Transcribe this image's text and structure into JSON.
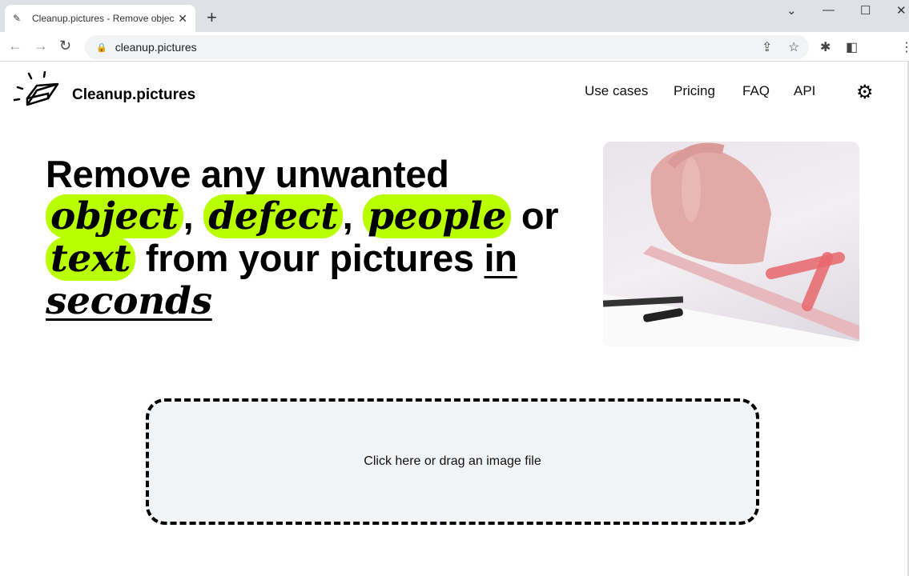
{
  "browser": {
    "tab_title": "Cleanup.pictures - Remove objec",
    "url": "cleanup.pictures"
  },
  "header": {
    "brand": "Cleanup.pictures",
    "menu": [
      "Use cases",
      "Pricing",
      "FAQ",
      "API"
    ]
  },
  "hero": {
    "line1": "Remove any unwanted",
    "w_object": "object",
    "comma": ",",
    "w_defect": "defect",
    "w_people": "people",
    "or": "or",
    "w_text": "text",
    "mid": "from your pictures",
    "in": "in",
    "seconds": "seconds"
  },
  "upload": {
    "label": "Click here or drag an image file"
  },
  "colors": {
    "highlight": "#b9ff00"
  }
}
